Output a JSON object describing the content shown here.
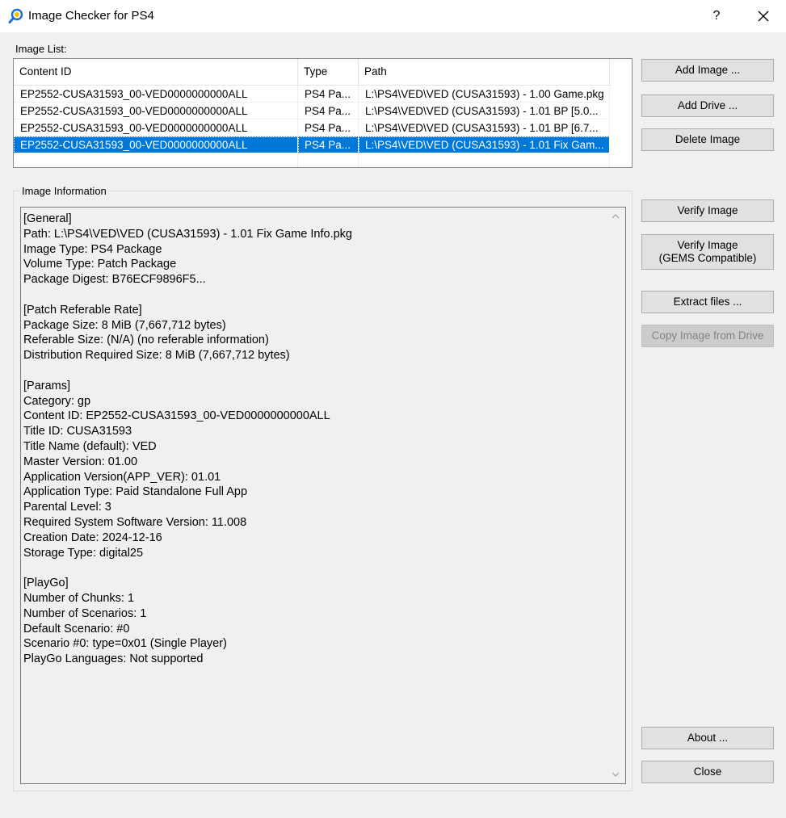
{
  "window": {
    "title": "Image Checker for PS4"
  },
  "titlebar": {
    "help_label": "?"
  },
  "image_list": {
    "label": "Image List:",
    "columns": [
      "Content ID",
      "Type",
      "Path"
    ],
    "rows": [
      {
        "content_id": "EP2552-CUSA31593_00-VED0000000000ALL",
        "type": "PS4 Pa...",
        "path": "L:\\PS4\\VED\\VED (CUSA31593) - 1.00 Game.pkg",
        "selected": false
      },
      {
        "content_id": "EP2552-CUSA31593_00-VED0000000000ALL",
        "type": "PS4 Pa...",
        "path": "L:\\PS4\\VED\\VED (CUSA31593) - 1.01 BP [5.0...",
        "selected": false
      },
      {
        "content_id": "EP2552-CUSA31593_00-VED0000000000ALL",
        "type": "PS4 Pa...",
        "path": "L:\\PS4\\VED\\VED (CUSA31593) - 1.01 BP [6.7...",
        "selected": false
      },
      {
        "content_id": "EP2552-CUSA31593_00-VED0000000000ALL",
        "type": "PS4 Pa...",
        "path": "L:\\PS4\\VED\\VED (CUSA31593) - 1.01 Fix Gam...",
        "selected": true
      }
    ]
  },
  "image_info": {
    "label": "Image Information",
    "lines": [
      "[General]",
      "Path: L:\\PS4\\VED\\VED (CUSA31593) - 1.01 Fix Game Info.pkg",
      "Image Type: PS4 Package",
      "Volume Type: Patch Package",
      "Package Digest: B76ECF9896F5...",
      "",
      "[Patch Referable Rate]",
      "Package Size: 8 MiB (7,667,712 bytes)",
      "Referable Size: (N/A) (no referable information)",
      "Distribution Required Size: 8 MiB (7,667,712 bytes)",
      "",
      "[Params]",
      "Category: gp",
      "Content ID: EP2552-CUSA31593_00-VED0000000000ALL",
      "Title ID: CUSA31593",
      "Title Name (default): VED",
      "Master Version: 01.00",
      "Application Version(APP_VER): 01.01",
      "Application Type: Paid Standalone Full App",
      "Parental Level: 3",
      "Required System Software Version: 11.008",
      "Creation Date: 2024-12-16",
      "Storage Type: digital25",
      "",
      "[PlayGo]",
      "Number of Chunks: 1",
      "Number of Scenarios: 1",
      "Default Scenario: #0",
      "Scenario #0: type=0x01 (Single Player)",
      "PlayGo Languages: Not supported"
    ]
  },
  "buttons": {
    "add_image": "Add Image ...",
    "add_drive": "Add Drive ...",
    "delete_image": "Delete Image",
    "verify_image": "Verify Image",
    "verify_gems": "Verify Image\n(GEMS Compatible)",
    "extract_files": "Extract files ...",
    "copy_from_drive": "Copy Image from Drive",
    "about": "About ...",
    "close": "Close"
  },
  "colors": {
    "selection": "#0078d7",
    "app_icon": "#1a6fd1"
  }
}
